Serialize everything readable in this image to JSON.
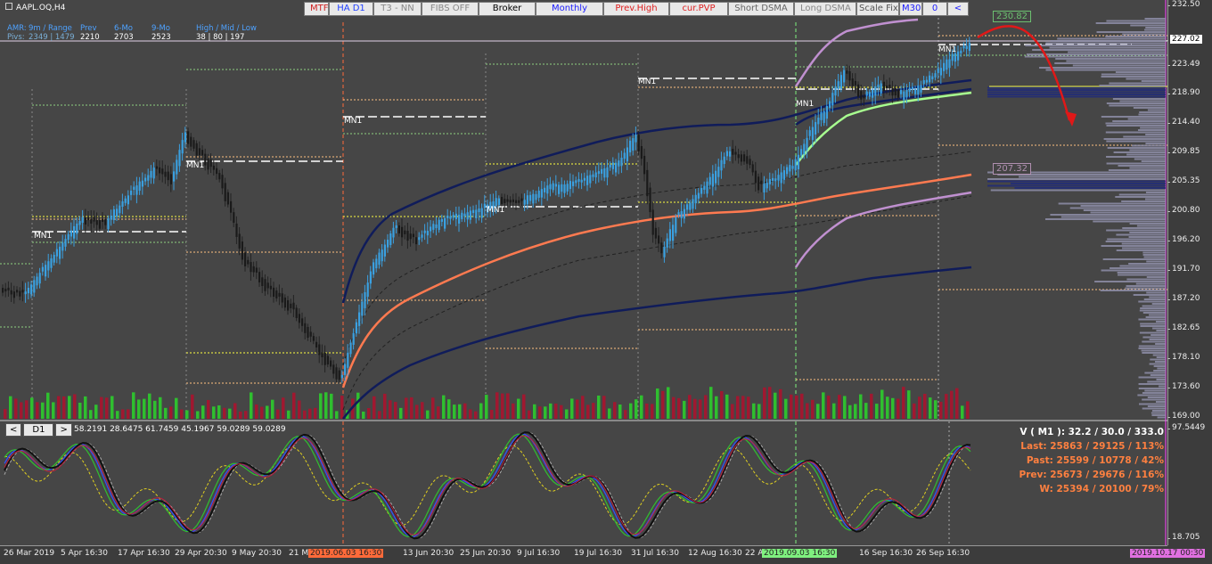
{
  "symbol": "AAPL.OQ,H4",
  "stats": {
    "header": [
      "AMR:",
      "9m / Range",
      "Prev",
      "6-Mo",
      "9-Mo",
      "High / Mid / Low"
    ],
    "row_label": "Pivs:",
    "row_values": [
      "2349 | 1479",
      "2210",
      "2703",
      "2523",
      "38 | 80 | 197"
    ]
  },
  "toolbar": [
    {
      "label": "MTF",
      "color": "#d02020"
    },
    {
      "label": "HA D1",
      "color": "#2040ff"
    },
    {
      "label": "T3 - NN",
      "color": "#888888"
    },
    {
      "label": "FIBS OFF",
      "color": "#888888"
    },
    {
      "label": "Broker",
      "color": "#000000"
    },
    {
      "label": "Monthly",
      "color": "#2020ff"
    },
    {
      "label": "Prev.High",
      "color": "#e02020"
    },
    {
      "label": "cur.PVP",
      "color": "#e02020"
    },
    {
      "label": "Short DSMA",
      "color": "#666666"
    },
    {
      "label": "Long DSMA",
      "color": "#888888"
    },
    {
      "label": "Scale Fix",
      "color": "#555555"
    },
    {
      "label": "M30",
      "color": "#2020ff"
    },
    {
      "label": "0",
      "color": "#2020ff"
    },
    {
      "label": "<",
      "color": "#2020ff"
    }
  ],
  "mn1_label": "MN1",
  "price_axis": [
    "232.50",
    "227.02",
    "223.49",
    "218.90",
    "214.40",
    "209.85",
    "205.35",
    "200.80",
    "196.20",
    "191.70",
    "187.20",
    "182.65",
    "178.10",
    "173.60",
    "169.00",
    "97.5449",
    "18.705"
  ],
  "current_price": "227.02",
  "price_tag_upper": "230.82",
  "price_tag_lower": "207.32",
  "time_axis": [
    "26 Mar 2019",
    "5 Apr 16:30",
    "17 Apr 16:30",
    "29 Apr 20:30",
    "9 May 20:30",
    "21 M",
    "2019.06.03 16:30",
    "13 Jun 20:30",
    "25 Jun 20:30",
    "9 Jul 16:30",
    "19 Jul 16:30",
    "31 Jul 16:30",
    "12 Aug 16:30",
    "22 A",
    "2019.09.03 16:30",
    "16 Sep 16:30",
    "26 Sep 16:30",
    "2019.10.17 00:30"
  ],
  "sub": {
    "nav": [
      "<",
      "D1",
      ">"
    ],
    "values": "58.2191 28.6475 61.7459 45.1967 59.0289 59.0289"
  },
  "volume_info": {
    "head": "V ( M1 ): 32.2 / 30.0 / 333.0",
    "lines": [
      "Last: 25863 / 29125 / 113%",
      "Past: 25599 / 10778 / 42%",
      "Prev: 25673 / 29676 / 116%",
      "W: 25394 / 20100 / 79%"
    ]
  },
  "colors": {
    "bull": "#3aa0e0",
    "bear": "#1a1a1a",
    "ema": "#ff7a50",
    "band": "#101c5a",
    "envelope": "#c090d0",
    "fast": "#a8ff90"
  }
}
